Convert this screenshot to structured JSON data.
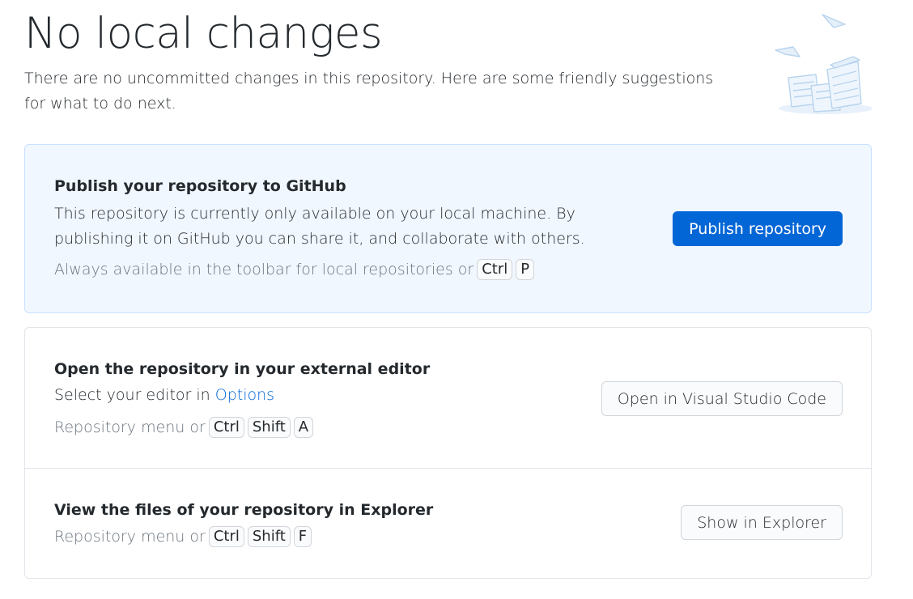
{
  "header": {
    "title": "No local changes",
    "intro": "There are no uncommitted changes in this repository. Here are some friendly suggestions for what to do next."
  },
  "illustration": {
    "icon": "paper-stacks-illustration-icon"
  },
  "publish": {
    "title": "Publish your repository to GitHub",
    "description": "This repository is currently only available on your local machine. By publishing it on GitHub you can share it, and collaborate with others.",
    "hint": "Always available in the toolbar for local repositories or",
    "keys": [
      "Ctrl",
      "P"
    ],
    "button": "Publish repository"
  },
  "editor": {
    "title": "Open the repository in your external editor",
    "description_prefix": "Select your editor in",
    "description_link": "Options",
    "hint": "Repository menu or",
    "keys": [
      "Ctrl",
      "Shift",
      "A"
    ],
    "button": "Open in Visual Studio Code"
  },
  "explorer": {
    "title": "View the files of your repository in Explorer",
    "hint": "Repository menu or",
    "keys": [
      "Ctrl",
      "Shift",
      "F"
    ],
    "button": "Show in Explorer"
  },
  "colors": {
    "accent": "#0366d6",
    "publish_bg": "#f1f7fe",
    "muted_text": "#6a737d"
  }
}
